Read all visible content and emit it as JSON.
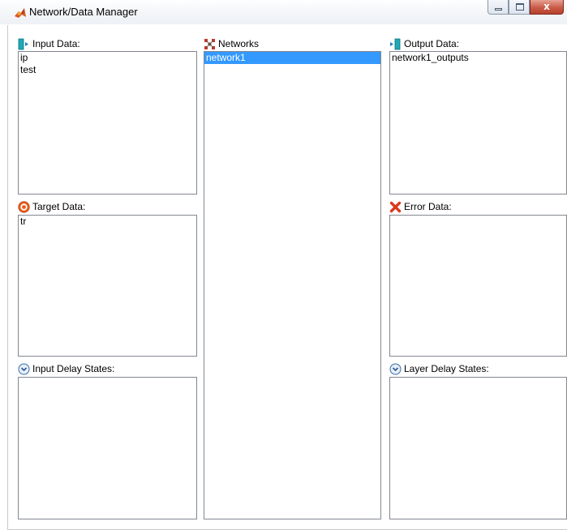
{
  "window": {
    "title": "Network/Data Manager",
    "close_glyph": "x"
  },
  "colors": {
    "selection": "#3399ff",
    "list_border": "#828790"
  },
  "panels": {
    "input_data": {
      "label": "Input Data:",
      "icon": "input-data-icon",
      "items": [
        "ip",
        "test"
      ]
    },
    "target_data": {
      "label": "Target Data:",
      "icon": "target-icon",
      "items": [
        "tr"
      ]
    },
    "input_delay_states": {
      "label": "Input Delay States:",
      "icon": "chevron-down-circle-icon",
      "items": []
    },
    "networks": {
      "label": "Networks",
      "icon": "network-icon",
      "items": [
        "network1"
      ],
      "selected": "network1"
    },
    "output_data": {
      "label": "Output Data:",
      "icon": "output-data-icon",
      "items": [
        "network1_outputs"
      ]
    },
    "error_data": {
      "label": "Error Data:",
      "icon": "error-x-icon",
      "items": []
    },
    "layer_delay_states": {
      "label": "Layer Delay States:",
      "icon": "chevron-down-circle-icon",
      "items": []
    }
  }
}
